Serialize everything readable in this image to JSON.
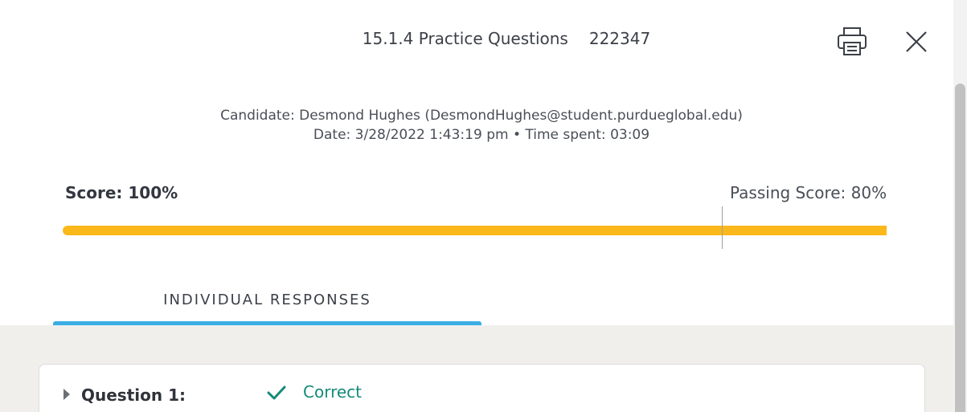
{
  "header": {
    "quiz_title": "15.1.4 Practice Questions",
    "quiz_id": "222347",
    "icons": {
      "print": "printer-icon",
      "close": "close-icon"
    }
  },
  "candidate": {
    "line1": "Candidate: Desmond Hughes  (DesmondHughes@student.purdueglobal.edu)",
    "line2": "Date: 3/28/2022 1:43:19 pm • Time spent: 03:09"
  },
  "score": {
    "score_label": "Score: 100%",
    "passing_label": "Passing Score: 80%",
    "score_percent": 100,
    "passing_percent": 80
  },
  "tabs": [
    {
      "label": "INDIVIDUAL RESPONSES",
      "active": true
    }
  ],
  "questions": [
    {
      "label": "Question 1:",
      "status": "Correct",
      "status_icon": "checkmark-icon"
    }
  ],
  "colors": {
    "score_bar": "#fbb81b",
    "tab_underline": "#3aaee4",
    "correct": "#138a78",
    "panel_background": "#f0efec"
  }
}
